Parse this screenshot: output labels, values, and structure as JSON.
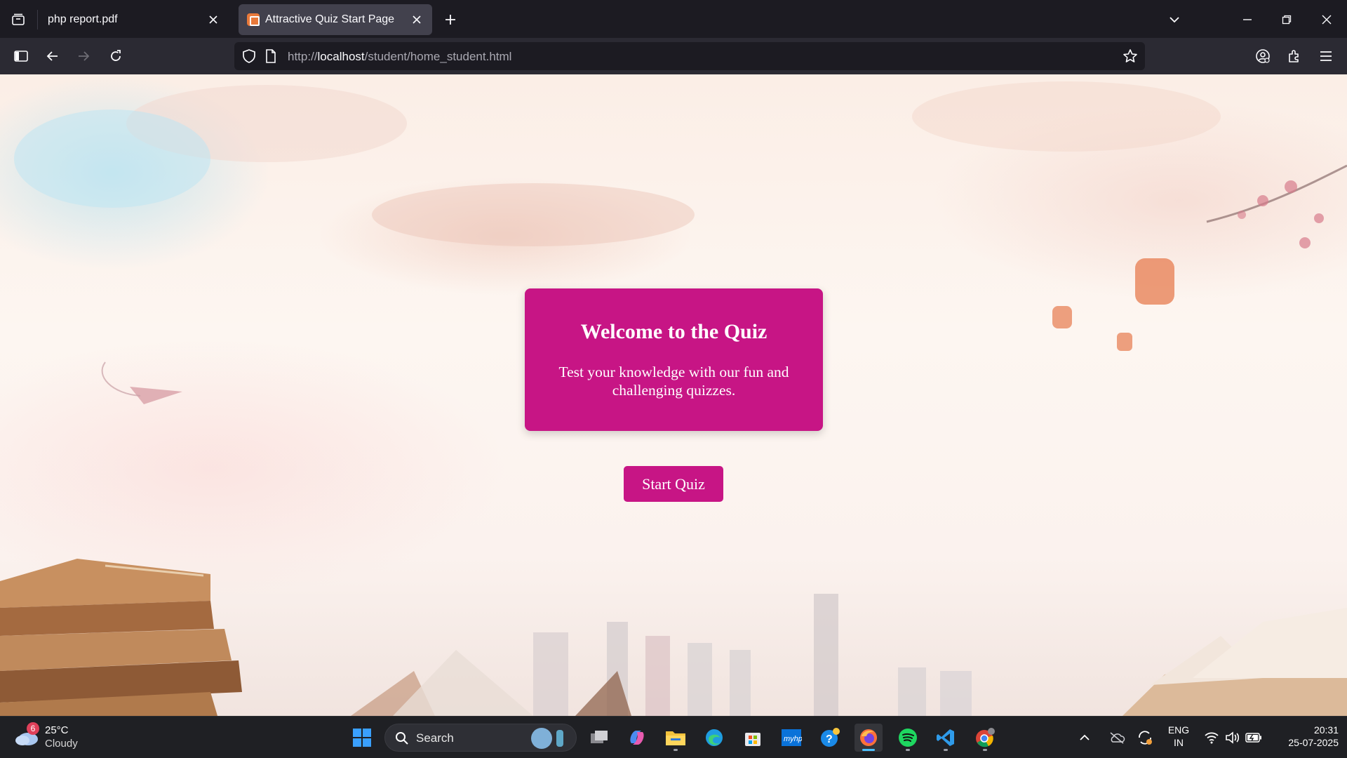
{
  "browser": {
    "tabs": [
      {
        "title": "php report.pdf",
        "active": false
      },
      {
        "title": "Attractive Quiz Start Page",
        "active": true
      }
    ],
    "url": {
      "scheme": "http://",
      "host": "localhost",
      "path": "/student/home_student.html"
    }
  },
  "page": {
    "card": {
      "heading": "Welcome to the Quiz",
      "text": "Test your knowledge with our fun and challenging quizzes."
    },
    "start_button": "Start Quiz",
    "colors": {
      "accent": "#c71585"
    }
  },
  "taskbar": {
    "weather": {
      "badge": "6",
      "temp": "25°C",
      "condition": "Cloudy"
    },
    "search_label": "Search",
    "pinned": [
      "task-view",
      "copilot",
      "file-explorer",
      "edge",
      "store",
      "myhp",
      "get-help",
      "firefox",
      "spotify",
      "vscode",
      "chrome"
    ],
    "tray": {
      "lang_top": "ENG",
      "lang_bottom": "IN",
      "time": "20:31",
      "date": "25-07-2025"
    }
  }
}
